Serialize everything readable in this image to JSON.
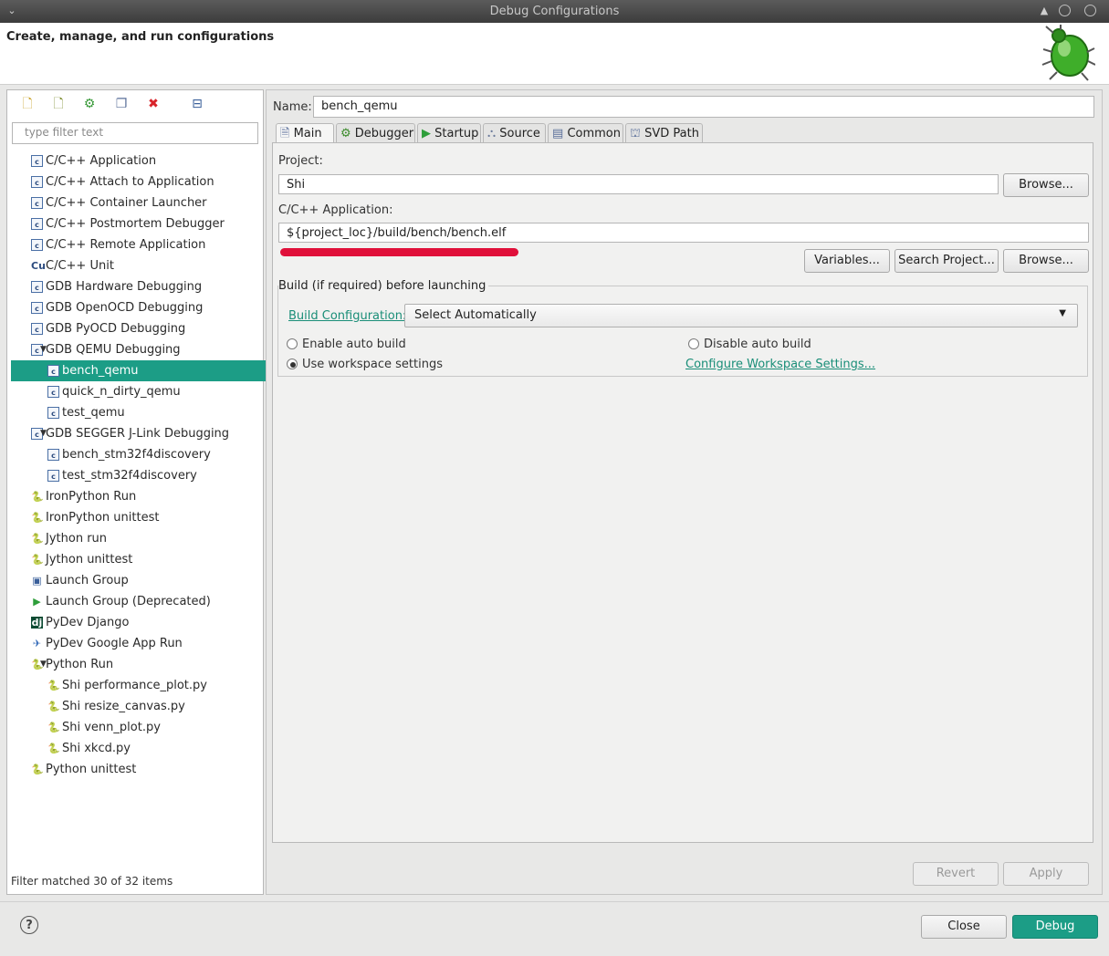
{
  "window": {
    "title": "Debug Configurations"
  },
  "header": {
    "title": "Create, manage, and run configurations"
  },
  "left": {
    "filter_placeholder": "type filter text",
    "status": "Filter matched 30 of 32 items",
    "tree": [
      {
        "label": "C/C++ Application",
        "level": 1,
        "icon": "c-app-icon"
      },
      {
        "label": "C/C++ Attach to Application",
        "level": 1,
        "icon": "c-app-icon"
      },
      {
        "label": "C/C++ Container Launcher",
        "level": 1,
        "icon": "c-app-icon"
      },
      {
        "label": "C/C++ Postmortem Debugger",
        "level": 1,
        "icon": "c-app-icon"
      },
      {
        "label": "C/C++ Remote Application",
        "level": 1,
        "icon": "c-app-icon"
      },
      {
        "label": "C/C++ Unit",
        "level": 1,
        "icon": "c-unit-icon"
      },
      {
        "label": "GDB Hardware Debugging",
        "level": 1,
        "icon": "c-app-icon"
      },
      {
        "label": "GDB OpenOCD Debugging",
        "level": 1,
        "icon": "c-app-icon"
      },
      {
        "label": "GDB PyOCD Debugging",
        "level": 1,
        "icon": "c-app-icon"
      },
      {
        "label": "GDB QEMU Debugging",
        "level": 1,
        "icon": "c-app-icon",
        "expanded": true
      },
      {
        "label": "bench_qemu",
        "level": 2,
        "icon": "c-app-icon",
        "selected": true
      },
      {
        "label": "quick_n_dirty_qemu",
        "level": 2,
        "icon": "c-app-icon"
      },
      {
        "label": "test_qemu",
        "level": 2,
        "icon": "c-app-icon"
      },
      {
        "label": "GDB SEGGER J-Link Debugging",
        "level": 1,
        "icon": "c-app-icon",
        "expanded": true
      },
      {
        "label": "bench_stm32f4discovery",
        "level": 2,
        "icon": "c-app-icon"
      },
      {
        "label": "test_stm32f4discovery",
        "level": 2,
        "icon": "c-app-icon"
      },
      {
        "label": "IronPython Run",
        "level": 1,
        "icon": "python-icon"
      },
      {
        "label": "IronPython unittest",
        "level": 1,
        "icon": "python-unittest-icon"
      },
      {
        "label": "Jython run",
        "level": 1,
        "icon": "jython-icon"
      },
      {
        "label": "Jython unittest",
        "level": 1,
        "icon": "jython-unittest-icon"
      },
      {
        "label": "Launch Group",
        "level": 1,
        "icon": "launch-group-icon"
      },
      {
        "label": "Launch Group (Deprecated)",
        "level": 1,
        "icon": "play-icon"
      },
      {
        "label": "PyDev Django",
        "level": 1,
        "icon": "django-icon"
      },
      {
        "label": "PyDev Google App Run",
        "level": 1,
        "icon": "google-app-icon"
      },
      {
        "label": "Python Run",
        "level": 1,
        "icon": "python-icon",
        "expanded": true
      },
      {
        "label": "Shi performance_plot.py",
        "level": 2,
        "icon": "python-icon"
      },
      {
        "label": "Shi resize_canvas.py",
        "level": 2,
        "icon": "python-icon"
      },
      {
        "label": "Shi venn_plot.py",
        "level": 2,
        "icon": "python-icon"
      },
      {
        "label": "Shi xkcd.py",
        "level": 2,
        "icon": "python-icon"
      },
      {
        "label": "Python unittest",
        "level": 1,
        "icon": "python-unittest-icon"
      }
    ]
  },
  "right": {
    "name_label": "Name:",
    "name_value": "bench_qemu",
    "tabs": [
      "Main",
      "Debugger",
      "Startup",
      "Source",
      "Common",
      "SVD Path"
    ],
    "project_label": "Project:",
    "project_value": "Shi",
    "browse": "Browse...",
    "app_label": "C/C++ Application:",
    "app_value": "${project_loc}/build/bench/bench.elf",
    "variables": "Variables...",
    "search_project": "Search Project...",
    "build_group": "Build (if required) before launching",
    "build_config_link": "Build Configuration:",
    "build_config_value": "Select Automatically",
    "enable_auto": "Enable auto build",
    "disable_auto": "Disable auto build",
    "use_workspace": "Use workspace settings",
    "configure_link": "Configure Workspace Settings...",
    "revert": "Revert",
    "apply": "Apply"
  },
  "footer": {
    "close": "Close",
    "debug": "Debug",
    "help": "?"
  },
  "colors": {
    "accent": "#1c9d86",
    "redaction": "#e0103a"
  }
}
